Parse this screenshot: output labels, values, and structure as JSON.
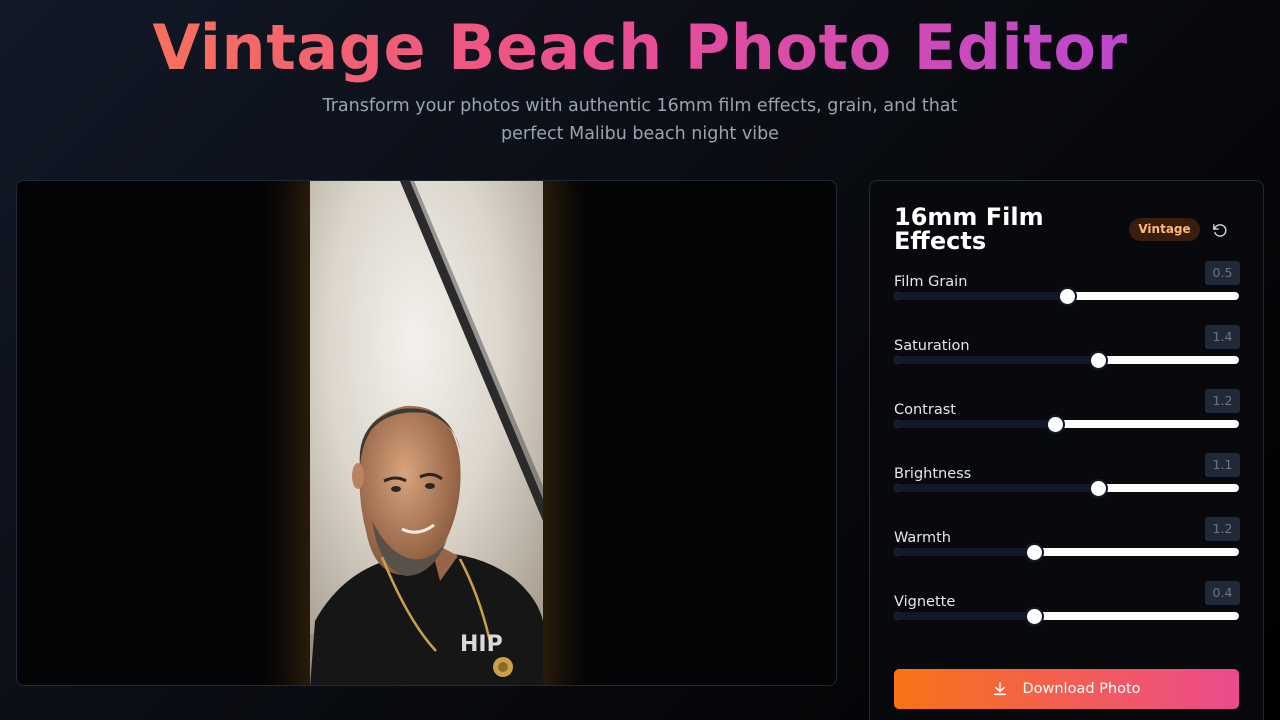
{
  "header": {
    "title": "Vintage Beach Photo Editor",
    "subtitle": "Transform your photos with authentic 16mm film effects, grain, and that perfect Malibu beach night vibe"
  },
  "controls": {
    "title": "16mm Film Effects",
    "badge": "Vintage",
    "reset_icon": "rotate-ccw-icon",
    "sliders": [
      {
        "label": "Film Grain",
        "value": "0.5",
        "fraction": 0.5
      },
      {
        "label": "Saturation",
        "value": "1.4",
        "fraction": 0.59
      },
      {
        "label": "Contrast",
        "value": "1.2",
        "fraction": 0.466
      },
      {
        "label": "Brightness",
        "value": "1.1",
        "fraction": 0.59
      },
      {
        "label": "Warmth",
        "value": "1.2",
        "fraction": 0.405
      },
      {
        "label": "Vignette",
        "value": "0.4",
        "fraction": 0.405
      }
    ],
    "download_label": "Download Photo",
    "download_icon": "download-icon"
  },
  "colors": {
    "title_gradient": [
      "#fb7b4a",
      "#ec4f8e",
      "#b045e0"
    ],
    "badge_bg": "#3a1d0e",
    "badge_text": "#fdba74",
    "download_gradient": [
      "#f97316",
      "#ec4a8e"
    ]
  }
}
